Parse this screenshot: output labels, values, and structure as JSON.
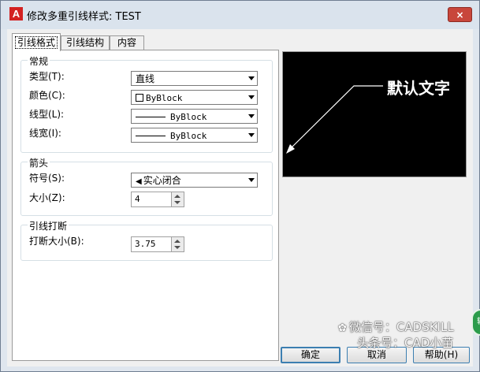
{
  "window": {
    "app_icon": "A",
    "title": "修改多重引线样式: TEST",
    "close": "×"
  },
  "tabs": [
    {
      "label": "引线格式",
      "active": true
    },
    {
      "label": "引线结构",
      "active": false
    },
    {
      "label": "内容",
      "active": false
    }
  ],
  "general": {
    "heading": "常规",
    "type": {
      "label": "类型(T):",
      "value": "直线"
    },
    "color": {
      "label": "颜色(C):",
      "value": "ByBlock"
    },
    "linetype": {
      "label": "线型(L):",
      "value": "ByBlock"
    },
    "lineweight": {
      "label": "线宽(I):",
      "value": "ByBlock"
    }
  },
  "arrowhead": {
    "heading": "箭头",
    "symbol": {
      "label": "符号(S):",
      "value": "实心闭合"
    },
    "size": {
      "label": "大小(Z):",
      "value": "4"
    }
  },
  "leader_break": {
    "heading": "引线打断",
    "break_size": {
      "label": "打断大小(B):",
      "value": "3.75"
    }
  },
  "preview": {
    "text": "默认文字",
    "background": "#000000",
    "line_color": "#ffffff"
  },
  "buttons": {
    "ok": "确定",
    "cancel": "取消",
    "help": "帮助(H)"
  },
  "watermark": {
    "line1": "微信号：CADSKILL",
    "line2": "头条号：CAD小苗"
  },
  "badge": "转"
}
